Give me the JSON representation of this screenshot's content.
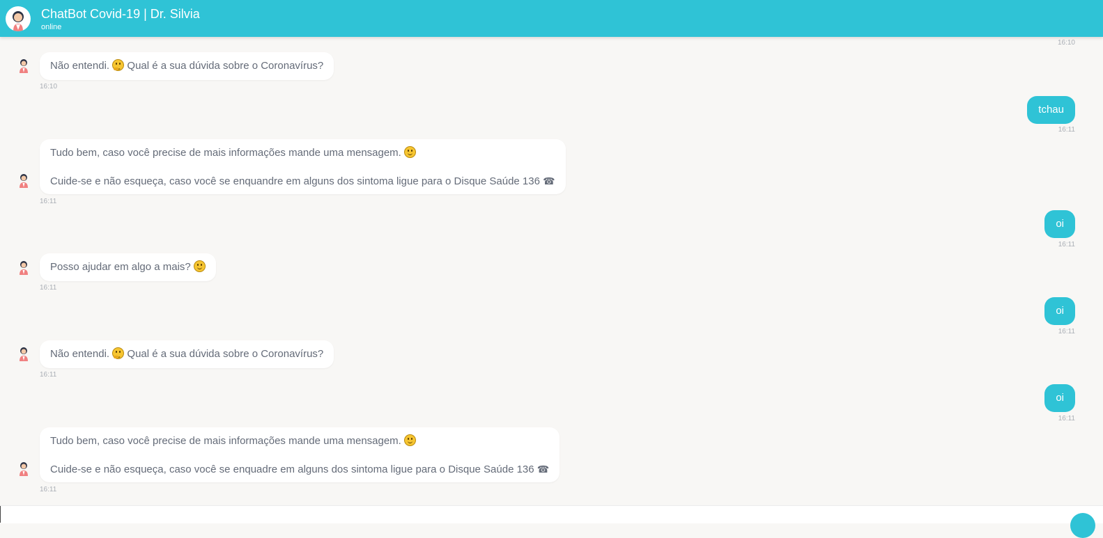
{
  "header": {
    "title": "ChatBot Covid-19 | Dr. Silvia",
    "status": "online"
  },
  "colors": {
    "accent": "#2fc3d6",
    "background": "#f8f7f5",
    "bot_bubble": "#ffffff"
  },
  "messages": [
    {
      "from": "user",
      "time": "16:10"
    },
    {
      "from": "bot",
      "lines": [
        "Não entendi.",
        "Qual é a sua dúvida sobre o Coronavírus?"
      ],
      "emoji": "thinking-face-icon",
      "time": "16:10"
    },
    {
      "from": "user",
      "text": "tchau",
      "time": "16:11"
    },
    {
      "from": "bot",
      "line1": "Tudo bem, caso você precise de mais informações mande uma mensagem.",
      "line2": "Cuide-se e não esqueça, caso você se enquandre em alguns dos sintoma ligue para o Disque Saúde 136",
      "emoji": "smiley-icon",
      "icon": "phone-icon",
      "time": "16:11"
    },
    {
      "from": "user",
      "text": "oi",
      "time": "16:11"
    },
    {
      "from": "bot",
      "text": "Posso ajudar em algo a mais?",
      "emoji": "smiley-icon",
      "time": "16:11"
    },
    {
      "from": "user",
      "text": "oi",
      "time": "16:11"
    },
    {
      "from": "bot",
      "lines": [
        "Não entendi.",
        "Qual é a sua dúvida sobre o Coronavírus?"
      ],
      "emoji": "thinking-face-icon",
      "time": "16:11"
    },
    {
      "from": "user",
      "text": "oi",
      "time": "16:11"
    },
    {
      "from": "bot",
      "line1": "Tudo bem, caso você precise de mais informações mande uma mensagem.",
      "line2": "Cuide-se e não esqueça, caso você se enquadre em alguns dos sintoma ligue para o Disque Saúde 136",
      "emoji": "smiley-icon",
      "icon": "phone-icon",
      "time": "16:11"
    }
  ],
  "phone_glyph": "☎"
}
